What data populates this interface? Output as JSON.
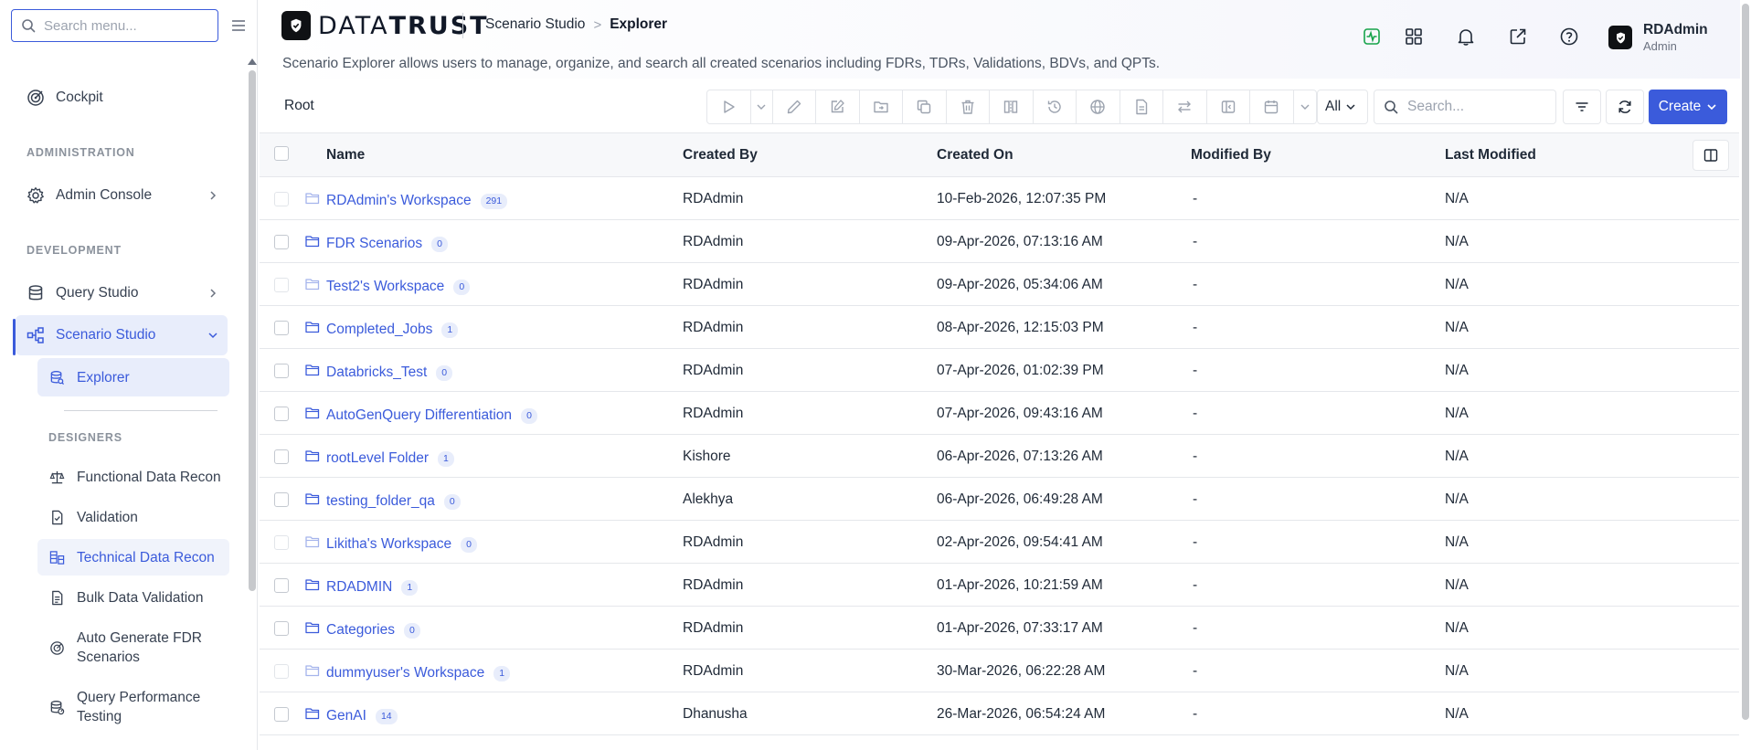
{
  "sidebar": {
    "search_placeholder": "Search menu...",
    "items": {
      "cockpit": "Cockpit",
      "admin_section": "ADMINISTRATION",
      "admin_console": "Admin Console",
      "dev_section": "DEVELOPMENT",
      "query_studio": "Query Studio",
      "scenario_studio": "Scenario Studio",
      "explorer": "Explorer",
      "designers_section": "DESIGNERS",
      "functional_data_recon": "Functional Data Recon",
      "validation": "Validation",
      "technical_data_recon": "Technical Data Recon",
      "bulk_data_validation": "Bulk Data Validation",
      "auto_generate_line1": "Auto Generate FDR",
      "auto_generate_line2": "Scenarios",
      "qpt_line1": "Query Performance",
      "qpt_line2": "Testing"
    }
  },
  "header": {
    "logo_part1": "DATA",
    "logo_part2": "TRUST",
    "breadcrumb": [
      "Scenario Studio",
      "Explorer"
    ],
    "description": "Scenario Explorer allows users to manage, organize, and search all created scenarios including FDRs, TDRs, Validations, BDVs, and QPTs.",
    "user_name": "RDAdmin",
    "user_role": "Admin",
    "icons": [
      "activity-icon",
      "apps-grid-icon",
      "bell-icon",
      "external-link-icon",
      "help-icon"
    ],
    "accent_color": "#3b5bdb"
  },
  "toolbar": {
    "root_label": "Root",
    "filter_select": "All",
    "search_placeholder": "Search...",
    "create_label": "Create"
  },
  "table": {
    "columns": [
      "Name",
      "Created By",
      "Created On",
      "Modified By",
      "Last Modified"
    ],
    "rows": [
      {
        "name": "RDAdmin's Workspace",
        "count": "291",
        "created_by": "RDAdmin",
        "created_on": "10-Feb-2026, 12:07:35 PM",
        "modified_by": "-",
        "last_modified": "N/A"
      },
      {
        "name": "FDR Scenarios",
        "count": "0",
        "created_by": "RDAdmin",
        "created_on": "09-Apr-2026, 07:13:16 AM",
        "modified_by": "-",
        "last_modified": "N/A"
      },
      {
        "name": "Test2's Workspace",
        "count": "0",
        "created_by": "RDAdmin",
        "created_on": "09-Apr-2026, 05:34:06 AM",
        "modified_by": "-",
        "last_modified": "N/A"
      },
      {
        "name": "Completed_Jobs",
        "count": "1",
        "created_by": "RDAdmin",
        "created_on": "08-Apr-2026, 12:15:03 PM",
        "modified_by": "-",
        "last_modified": "N/A"
      },
      {
        "name": "Databricks_Test",
        "count": "0",
        "created_by": "RDAdmin",
        "created_on": "07-Apr-2026, 01:02:39 PM",
        "modified_by": "-",
        "last_modified": "N/A"
      },
      {
        "name": "AutoGenQuery Differentiation",
        "count": "0",
        "created_by": "RDAdmin",
        "created_on": "07-Apr-2026, 09:43:16 AM",
        "modified_by": "-",
        "last_modified": "N/A"
      },
      {
        "name": "rootLevel Folder",
        "count": "1",
        "created_by": "Kishore",
        "created_on": "06-Apr-2026, 07:13:26 AM",
        "modified_by": "-",
        "last_modified": "N/A"
      },
      {
        "name": "testing_folder_qa",
        "count": "0",
        "created_by": "Alekhya",
        "created_on": "06-Apr-2026, 06:49:28 AM",
        "modified_by": "-",
        "last_modified": "N/A"
      },
      {
        "name": "Likitha's Workspace",
        "count": "0",
        "created_by": "RDAdmin",
        "created_on": "02-Apr-2026, 09:54:41 AM",
        "modified_by": "-",
        "last_modified": "N/A"
      },
      {
        "name": "RDADMIN",
        "count": "1",
        "created_by": "RDAdmin",
        "created_on": "01-Apr-2026, 10:21:59 AM",
        "modified_by": "-",
        "last_modified": "N/A"
      },
      {
        "name": "Categories",
        "count": "0",
        "created_by": "RDAdmin",
        "created_on": "01-Apr-2026, 07:33:17 AM",
        "modified_by": "-",
        "last_modified": "N/A"
      },
      {
        "name": "dummyuser's Workspace",
        "count": "1",
        "created_by": "RDAdmin",
        "created_on": "30-Mar-2026, 06:22:28 AM",
        "modified_by": "-",
        "last_modified": "N/A"
      },
      {
        "name": "GenAI",
        "count": "14",
        "created_by": "Dhanusha",
        "created_on": "26-Mar-2026, 06:54:24 AM",
        "modified_by": "-",
        "last_modified": "N/A"
      }
    ]
  }
}
